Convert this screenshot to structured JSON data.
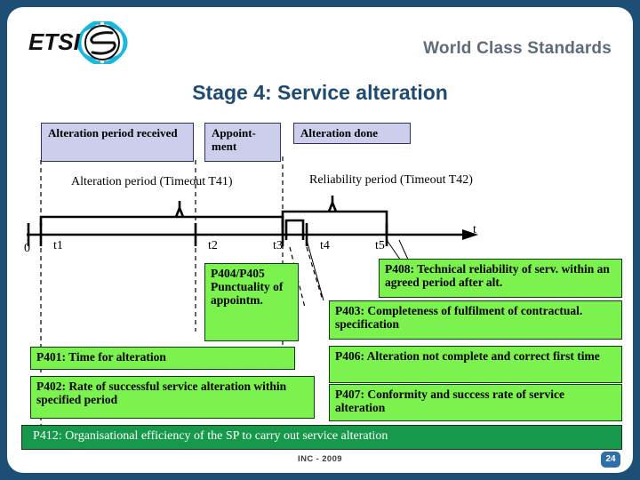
{
  "header": {
    "tagline": "World Class Standards",
    "logo_alt": "etsi-logo",
    "title": "Stage 4: Service alteration"
  },
  "phase_boxes": [
    {
      "label": "Alteration period received"
    },
    {
      "label": "Appoint- ment"
    },
    {
      "label": "Alteration done"
    }
  ],
  "period_labels": [
    {
      "label": "Alteration period (Timeout T41)"
    },
    {
      "label": "Reliability period (Timeout T42)"
    }
  ],
  "timeline": {
    "origin_label": "0",
    "axis_label": "t",
    "ticks": [
      "t1",
      "t2",
      "t3",
      "t4",
      "t5"
    ]
  },
  "measures": {
    "p404_405": "P404/P405 Punctuality of appointm.",
    "p408": "P408: Technical reliability of serv. within an agreed period after alt.",
    "p403": "P403: Completeness of fulfilment of contractual. specification",
    "p401": "P401: Time for alteration",
    "p402": "P402: Rate of successful service alteration within specified period",
    "p406": "P406: Alteration not complete and correct first time",
    "p407": "P407: Conformity and success rate of service alteration",
    "p412": "P412: Organisational efficiency of the SP  to carry out service alteration"
  },
  "footer": {
    "text": "INC - 2009",
    "page_number": "24"
  },
  "colors": {
    "background": "#1d4e74",
    "slide": "#ffffff",
    "title": "#1f4a72",
    "tagline": "#5d6b7a",
    "phase_box_fill": "#cdcdec",
    "measure_fill": "#7cf24e",
    "band_fill": "#16994a",
    "badge": "#2e6fa8"
  }
}
